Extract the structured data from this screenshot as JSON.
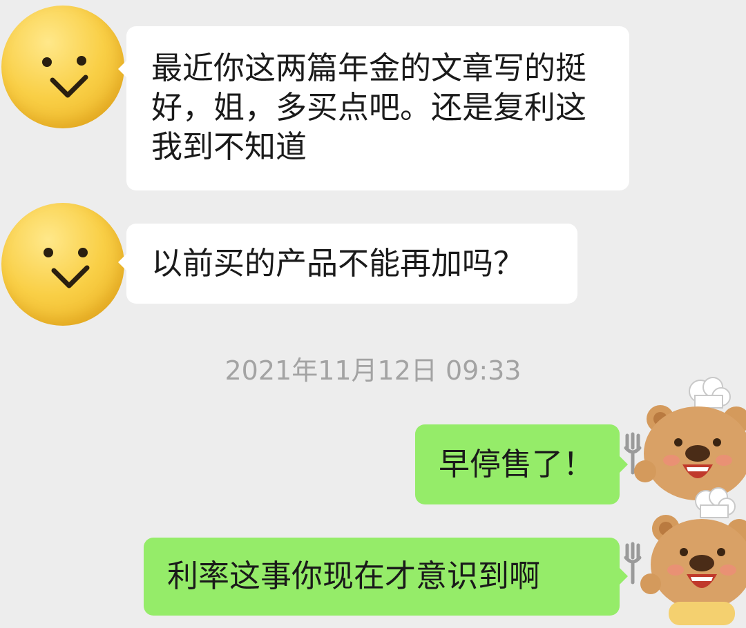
{
  "messages": [
    {
      "sender": "other",
      "avatar": "smiley-face-icon",
      "text": "最近你这两篇年金的文章写的挺好，姐，多买点吧。还是复利这我到不知道"
    },
    {
      "sender": "other",
      "avatar": "smiley-face-icon",
      "text": "以前买的产品不能再加吗？"
    },
    {
      "sender": "self",
      "avatar": "chef-bear-icon",
      "text": "早停售了！"
    },
    {
      "sender": "self",
      "avatar": "chef-bear-icon",
      "text": "利率这事你现在才意识到啊"
    }
  ],
  "timestamp": "2021年11月12日 09:33",
  "colors": {
    "background": "#ededed",
    "incoming_bubble": "#ffffff",
    "outgoing_bubble": "#95ec69",
    "timestamp_text": "#a3a3a3",
    "smiley_yellow": "#f9cf46",
    "bear_brown": "#d49a5c"
  }
}
